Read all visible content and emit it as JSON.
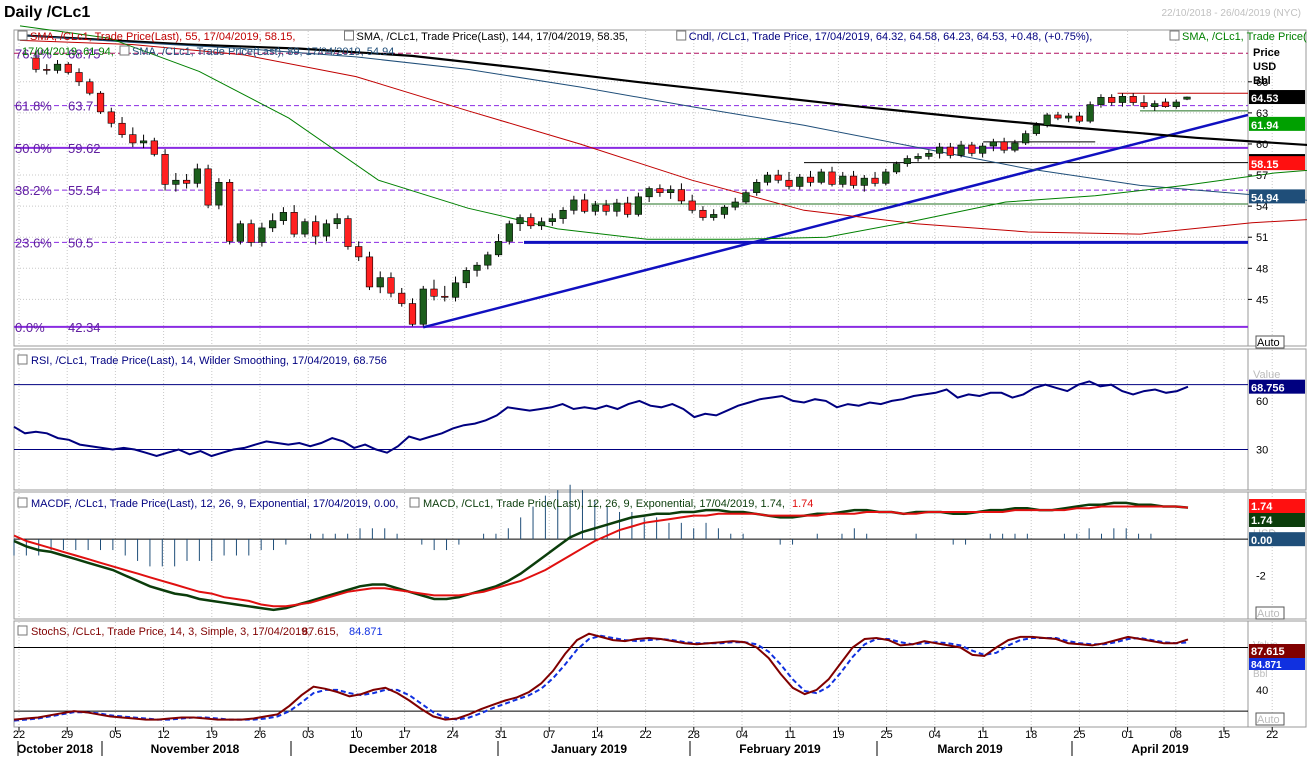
{
  "header": {
    "title": "Daily /CLc1",
    "date_range": "22/10/2018 - 26/04/2019 (NYC)"
  },
  "price_panel": {
    "legend": [
      {
        "text": "SMA, /CLc1, Trade Price(Last),  55, 17/04/2019, 58.15,",
        "color": "#c00000"
      },
      {
        "text": "SMA, /CLc1, Trade Price(Last),  144, 17/04/2019, 58.35,",
        "color": "#000000"
      },
      {
        "text": "Cndl, /CLc1, Trade Price,  17/04/2019, 64.32, 64.58, 64.23, 64.53, +0.48, (+0.75%),",
        "color": "#000080"
      },
      {
        "text": "SMA, /CLc1, Trade Price(Last),  21,",
        "color": "#008000"
      },
      {
        "text": "17/04/2019, 61.94,",
        "color": "#008000"
      },
      {
        "text": "SMA, /CLc1, Trade Price(Last),  89, 17/04/2019, 54.94",
        "color": "#1f4e79"
      }
    ],
    "axis_title": [
      "Price",
      "USD",
      "Bbl"
    ],
    "ticks": [
      "66",
      "63",
      "60",
      "57",
      "54",
      "51",
      "48",
      "45"
    ],
    "auto": "Auto",
    "fib_levels": [
      {
        "label": "76.4%",
        "value": "68.75",
        "y": 68.75
      },
      {
        "label": "61.8%",
        "value": "63.7",
        "y": 63.7
      },
      {
        "label": "50.0%",
        "value": "59.62",
        "y": 59.62
      },
      {
        "label": "38.2%",
        "value": "55.54",
        "y": 55.54
      },
      {
        "label": "23.6%",
        "value": "50.5",
        "y": 50.5
      },
      {
        "label": "0.0%",
        "value": "42.34",
        "y": 42.34
      }
    ],
    "value_tags": [
      {
        "text": "64.53",
        "y": 64.53,
        "bg": "#000000",
        "fg": "#ffffff"
      },
      {
        "text": "61.94",
        "y": 61.94,
        "bg": "#00a000",
        "fg": "#ffffff"
      },
      {
        "text": "58.35",
        "y": 58.35,
        "bg": "#000000",
        "fg": "#ffffff"
      },
      {
        "text": "58.15",
        "y": 58.15,
        "bg": "#ff1010",
        "fg": "#ffffff"
      },
      {
        "text": "54.94",
        "y": 54.94,
        "bg": "#1f4e79",
        "fg": "#ffffff"
      }
    ]
  },
  "rsi_panel": {
    "legend": "RSI, /CLc1, Trade Price(Last),  14, Wilder Smoothing, 17/04/2019, 68.756",
    "axis_title": [
      "Value",
      "USD"
    ],
    "ticks": [
      "60",
      "30"
    ],
    "tag": "68.756"
  },
  "macd_panel": {
    "legend_a": "MACDF, /CLc1, Trade Price(Last),  12, 26, 9, Exponential, 17/04/2019, 0.00,",
    "legend_b": "MACD, /CLc1, Trade Price(Last),  12, 26, 9, Exponential, 17/04/2019, 1.74,",
    "legend_b_val": "1.74",
    "axis_title": "USD",
    "ticks": [
      "-2"
    ],
    "tags": [
      "1.74",
      "1.74",
      "0.00"
    ],
    "auto": "Auto"
  },
  "stoch_panel": {
    "legend_a": "StochS, /CLc1, Trade Price,  14, 3, Simple, 3, 17/04/2019,",
    "legend_a_val1": "87.615,",
    "legend_a_val2": "84.871",
    "axis_title": [
      "Value",
      "USD",
      "Bbl"
    ],
    "ticks": [
      "40"
    ],
    "tags": [
      "87.615",
      "84.871"
    ],
    "auto": "Auto"
  },
  "x_axis": {
    "day_ticks": [
      "22",
      "29",
      "05",
      "12",
      "19",
      "26",
      "03",
      "10",
      "17",
      "24",
      "31",
      "07",
      "14",
      "22",
      "28",
      "04",
      "11",
      "19",
      "25",
      "04",
      "11",
      "18",
      "25",
      "01",
      "08",
      "15",
      "22"
    ],
    "months": [
      "October 2018",
      "November 2018",
      "December 2018",
      "January 2019",
      "February 2019",
      "March 2019",
      "April 2019"
    ]
  },
  "chart_data": {
    "type": "candlestick",
    "title": "Daily /CLc1",
    "date_range": "22/10/2018 - 26/04/2019",
    "price_ylim": [
      40.5,
      71
    ],
    "ohlc_sample_last": {
      "date": "17/04/2019",
      "open": 64.32,
      "high": 64.58,
      "low": 64.23,
      "close": 64.53
    },
    "candles": [
      [
        68.3,
        68.9,
        66.9,
        67.2
      ],
      [
        67.2,
        67.7,
        66.7,
        67.1
      ],
      [
        67.1,
        68.1,
        66.8,
        67.7
      ],
      [
        67.7,
        67.9,
        66.7,
        66.9
      ],
      [
        66.9,
        67.3,
        65.6,
        66.0
      ],
      [
        66.0,
        66.3,
        64.7,
        64.9
      ],
      [
        64.9,
        65.1,
        62.9,
        63.1
      ],
      [
        63.1,
        63.5,
        61.6,
        62.0
      ],
      [
        62.0,
        62.6,
        60.6,
        60.9
      ],
      [
        60.9,
        61.6,
        59.7,
        60.1
      ],
      [
        60.1,
        60.9,
        59.6,
        60.3
      ],
      [
        60.3,
        60.6,
        58.8,
        59.0
      ],
      [
        59.0,
        59.5,
        55.5,
        56.1
      ],
      [
        56.1,
        57.2,
        55.4,
        56.5
      ],
      [
        56.5,
        57.1,
        55.7,
        56.2
      ],
      [
        56.2,
        58.1,
        55.8,
        57.6
      ],
      [
        57.6,
        58.0,
        53.8,
        54.1
      ],
      [
        54.1,
        56.7,
        53.7,
        56.3
      ],
      [
        56.3,
        56.6,
        50.3,
        50.6
      ],
      [
        50.6,
        52.6,
        50.3,
        52.3
      ],
      [
        52.3,
        52.7,
        50.1,
        50.5
      ],
      [
        50.5,
        52.4,
        50.1,
        51.9
      ],
      [
        51.9,
        53.3,
        51.5,
        52.6
      ],
      [
        52.6,
        53.9,
        52.2,
        53.4
      ],
      [
        53.4,
        54.1,
        51.0,
        51.3
      ],
      [
        51.3,
        52.8,
        51.0,
        52.5
      ],
      [
        52.5,
        53.1,
        50.3,
        51.1
      ],
      [
        51.1,
        52.7,
        50.6,
        52.3
      ],
      [
        52.3,
        53.3,
        51.8,
        52.8
      ],
      [
        52.8,
        53.1,
        49.8,
        50.1
      ],
      [
        50.1,
        50.6,
        48.7,
        49.1
      ],
      [
        49.1,
        49.6,
        45.9,
        46.2
      ],
      [
        46.2,
        47.7,
        45.6,
        47.1
      ],
      [
        47.1,
        47.6,
        45.2,
        45.6
      ],
      [
        45.6,
        46.1,
        44.3,
        44.6
      ],
      [
        44.6,
        45.1,
        42.4,
        42.6
      ],
      [
        42.6,
        46.3,
        42.4,
        46.0
      ],
      [
        46.0,
        46.9,
        44.9,
        45.3
      ],
      [
        45.3,
        46.3,
        44.8,
        45.2
      ],
      [
        45.2,
        47.2,
        44.8,
        46.6
      ],
      [
        46.6,
        48.1,
        46.1,
        47.8
      ],
      [
        47.8,
        48.6,
        47.2,
        48.3
      ],
      [
        48.3,
        49.6,
        47.9,
        49.3
      ],
      [
        49.3,
        51.3,
        49.1,
        50.6
      ],
      [
        50.6,
        52.6,
        50.3,
        52.3
      ],
      [
        52.3,
        53.2,
        51.6,
        52.9
      ],
      [
        52.9,
        53.3,
        51.8,
        52.1
      ],
      [
        52.1,
        52.9,
        51.7,
        52.5
      ],
      [
        52.5,
        53.3,
        52.1,
        52.8
      ],
      [
        52.8,
        53.9,
        52.3,
        53.6
      ],
      [
        53.6,
        55.0,
        53.2,
        54.6
      ],
      [
        54.6,
        55.2,
        53.3,
        53.5
      ],
      [
        53.5,
        54.5,
        53.1,
        54.1
      ],
      [
        54.1,
        54.6,
        53.1,
        53.5
      ],
      [
        53.5,
        54.7,
        53.0,
        54.3
      ],
      [
        54.3,
        54.9,
        52.9,
        53.2
      ],
      [
        53.2,
        55.3,
        53.0,
        54.9
      ],
      [
        54.9,
        55.9,
        54.4,
        55.7
      ],
      [
        55.7,
        56.1,
        54.9,
        55.3
      ],
      [
        55.3,
        56.0,
        54.7,
        55.6
      ],
      [
        55.6,
        56.2,
        54.2,
        54.5
      ],
      [
        54.5,
        55.1,
        53.3,
        53.6
      ],
      [
        53.6,
        54.0,
        52.6,
        52.9
      ],
      [
        52.9,
        53.7,
        52.6,
        53.2
      ],
      [
        53.2,
        54.1,
        52.8,
        53.9
      ],
      [
        53.9,
        54.8,
        53.6,
        54.4
      ],
      [
        54.4,
        55.5,
        54.2,
        55.3
      ],
      [
        55.3,
        56.6,
        55.0,
        56.3
      ],
      [
        56.3,
        57.3,
        56.0,
        57.0
      ],
      [
        57.0,
        57.5,
        56.2,
        56.5
      ],
      [
        56.5,
        57.3,
        55.6,
        55.9
      ],
      [
        55.9,
        57.1,
        55.6,
        56.8
      ],
      [
        56.8,
        57.4,
        55.9,
        56.3
      ],
      [
        56.3,
        57.6,
        56.1,
        57.3
      ],
      [
        57.3,
        57.8,
        55.9,
        56.1
      ],
      [
        56.1,
        57.3,
        55.8,
        56.9
      ],
      [
        56.9,
        57.4,
        55.7,
        56.0
      ],
      [
        56.0,
        57.0,
        55.4,
        56.7
      ],
      [
        56.7,
        57.3,
        55.9,
        56.2
      ],
      [
        56.2,
        57.6,
        56.0,
        57.3
      ],
      [
        57.3,
        58.3,
        57.1,
        58.1
      ],
      [
        58.1,
        58.9,
        57.8,
        58.6
      ],
      [
        58.6,
        59.1,
        58.3,
        58.8
      ],
      [
        58.8,
        59.4,
        58.5,
        59.1
      ],
      [
        59.1,
        60.1,
        58.6,
        59.7
      ],
      [
        59.7,
        60.1,
        58.6,
        58.9
      ],
      [
        58.9,
        60.3,
        58.7,
        59.9
      ],
      [
        59.9,
        60.2,
        58.8,
        59.1
      ],
      [
        59.1,
        60.1,
        58.7,
        59.8
      ],
      [
        59.8,
        60.5,
        59.3,
        60.2
      ],
      [
        60.2,
        60.6,
        59.1,
        59.4
      ],
      [
        59.4,
        60.4,
        59.2,
        60.1
      ],
      [
        60.1,
        61.3,
        59.9,
        61.0
      ],
      [
        61.0,
        62.1,
        60.8,
        61.8
      ],
      [
        61.8,
        63.0,
        61.6,
        62.8
      ],
      [
        62.8,
        63.1,
        62.3,
        62.5
      ],
      [
        62.5,
        63.0,
        62.1,
        62.7
      ],
      [
        62.7,
        63.1,
        62.0,
        62.2
      ],
      [
        62.2,
        64.1,
        62.0,
        63.8
      ],
      [
        63.8,
        64.8,
        63.5,
        64.5
      ],
      [
        64.5,
        64.8,
        63.7,
        64.0
      ],
      [
        64.0,
        64.9,
        63.6,
        64.6
      ],
      [
        64.6,
        64.9,
        63.7,
        64.0
      ],
      [
        64.0,
        64.7,
        63.4,
        63.6
      ],
      [
        63.6,
        64.2,
        63.2,
        63.9
      ],
      [
        64.05,
        64.4,
        63.5,
        63.6
      ],
      [
        63.6,
        64.3,
        63.4,
        64.05
      ],
      [
        64.32,
        64.58,
        64.23,
        64.53
      ]
    ],
    "sma_21_last": 61.94,
    "sma_55_last": 58.15,
    "sma_89_last": 54.94,
    "sma_144_last": 58.35,
    "sma21": [
      [
        0,
        71.4
      ],
      [
        8,
        70.2
      ],
      [
        16,
        67.0
      ],
      [
        24,
        62.5
      ],
      [
        32,
        56.5
      ],
      [
        40,
        53.8
      ],
      [
        48,
        51.8
      ],
      [
        56,
        50.8
      ],
      [
        64,
        50.8
      ],
      [
        72,
        51.0
      ],
      [
        80,
        52.6
      ],
      [
        88,
        54.4
      ],
      [
        96,
        55.0
      ],
      [
        104,
        56.0
      ],
      [
        112,
        57.2
      ],
      [
        120,
        57.9
      ],
      [
        128,
        58.2
      ],
      [
        136,
        59.6
      ],
      [
        144,
        61.1
      ],
      [
        152,
        61.94
      ]
    ],
    "sma55": [
      [
        0,
        70.0
      ],
      [
        10,
        69.6
      ],
      [
        20,
        68.6
      ],
      [
        30,
        66.5
      ],
      [
        40,
        63.2
      ],
      [
        50,
        60.0
      ],
      [
        60,
        56.5
      ],
      [
        70,
        53.6
      ],
      [
        80,
        52.3
      ],
      [
        90,
        51.5
      ],
      [
        100,
        51.3
      ],
      [
        110,
        52.4
      ],
      [
        120,
        53.0
      ],
      [
        130,
        53.6
      ],
      [
        140,
        55.6
      ],
      [
        152,
        58.15
      ]
    ],
    "sma89": [
      [
        0,
        70.5
      ],
      [
        10,
        69.8
      ],
      [
        20,
        69.2
      ],
      [
        30,
        68.4
      ],
      [
        40,
        67.2
      ],
      [
        50,
        65.5
      ],
      [
        60,
        63.6
      ],
      [
        70,
        61.8
      ],
      [
        80,
        59.7
      ],
      [
        90,
        57.6
      ],
      [
        100,
        56.0
      ],
      [
        110,
        55.1
      ],
      [
        120,
        54.0
      ],
      [
        130,
        53.4
      ],
      [
        140,
        53.5
      ],
      [
        152,
        54.94
      ]
    ],
    "sma144": [
      [
        0,
        70.5
      ],
      [
        15,
        69.6
      ],
      [
        25,
        69.2
      ],
      [
        35,
        68.5
      ],
      [
        45,
        67.3
      ],
      [
        55,
        66.0
      ],
      [
        65,
        64.8
      ],
      [
        75,
        63.6
      ],
      [
        85,
        62.5
      ],
      [
        95,
        61.5
      ],
      [
        105,
        60.6
      ],
      [
        115,
        59.9
      ],
      [
        125,
        59.6
      ],
      [
        135,
        59.2
      ],
      [
        145,
        58.6
      ],
      [
        152,
        58.35
      ]
    ],
    "rsi": {
      "last": 68.756,
      "levels": [
        70,
        30
      ]
    },
    "macd": {
      "macd_last": 1.74,
      "signal_last": 1.74,
      "hist_last": 0.0
    },
    "stoch": {
      "k_last": 87.615,
      "d_last": 84.871
    }
  }
}
